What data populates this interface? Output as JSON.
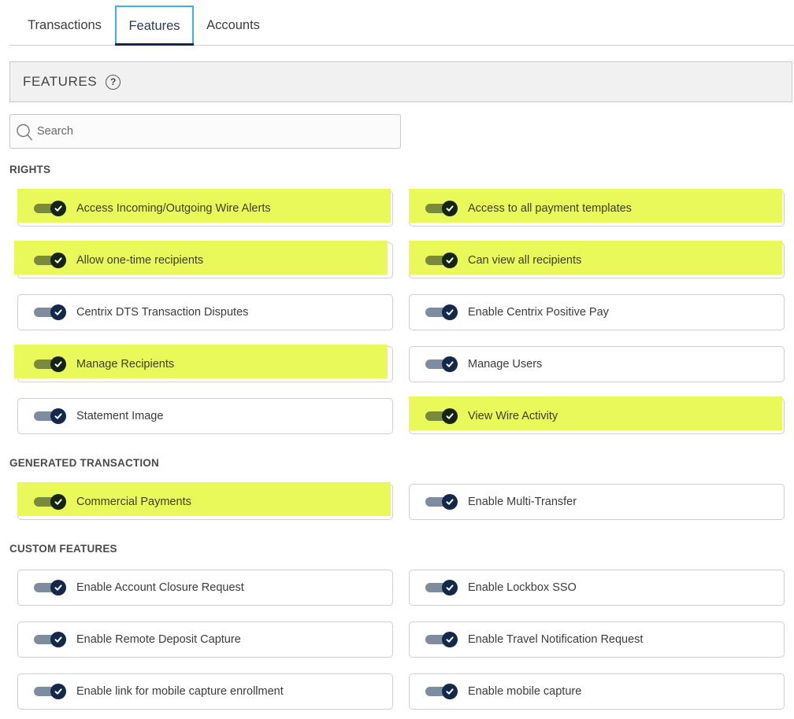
{
  "tabs": [
    {
      "label": "Transactions",
      "active": false
    },
    {
      "label": "Features",
      "active": true
    },
    {
      "label": "Accounts",
      "active": false
    }
  ],
  "header": {
    "title": "FEATURES",
    "help_icon": "question-circle-icon"
  },
  "search": {
    "placeholder": "Search",
    "value": "",
    "icon": "search-icon"
  },
  "colors": {
    "toggle_on_knob": "#13294b",
    "toggle_on_track": "#7d8c9e",
    "highlight": "#eaf95a",
    "tab_active_border": "#3fb0e8",
    "tab_active_underline": "#13294b"
  },
  "sections": [
    {
      "title": "RIGHTS",
      "items": [
        {
          "label": "Access Incoming/Outgoing Wire Alerts",
          "enabled": true,
          "highlighted": true
        },
        {
          "label": "Access to all payment templates",
          "enabled": true,
          "highlighted": true
        },
        {
          "label": "Allow one-time recipients",
          "enabled": true,
          "highlighted": true
        },
        {
          "label": "Can view all recipients",
          "enabled": true,
          "highlighted": true
        },
        {
          "label": "Centrix DTS Transaction Disputes",
          "enabled": true,
          "highlighted": false
        },
        {
          "label": "Enable Centrix Positive Pay",
          "enabled": true,
          "highlighted": false
        },
        {
          "label": "Manage Recipients",
          "enabled": true,
          "highlighted": true
        },
        {
          "label": "Manage Users",
          "enabled": true,
          "highlighted": false
        },
        {
          "label": "Statement Image",
          "enabled": true,
          "highlighted": false
        },
        {
          "label": "View Wire Activity",
          "enabled": true,
          "highlighted": true
        }
      ]
    },
    {
      "title": "GENERATED TRANSACTION",
      "items": [
        {
          "label": "Commercial Payments",
          "enabled": true,
          "highlighted": true
        },
        {
          "label": "Enable Multi-Transfer",
          "enabled": true,
          "highlighted": false
        }
      ]
    },
    {
      "title": "CUSTOM FEATURES",
      "items": [
        {
          "label": "Enable Account Closure Request",
          "enabled": true,
          "highlighted": false
        },
        {
          "label": "Enable Lockbox SSO",
          "enabled": true,
          "highlighted": false
        },
        {
          "label": "Enable Remote Deposit Capture",
          "enabled": true,
          "highlighted": false
        },
        {
          "label": "Enable Travel Notification Request",
          "enabled": true,
          "highlighted": false
        },
        {
          "label": "Enable link for mobile capture enrollment",
          "enabled": true,
          "highlighted": false
        },
        {
          "label": "Enable mobile capture",
          "enabled": true,
          "highlighted": false
        }
      ]
    }
  ]
}
